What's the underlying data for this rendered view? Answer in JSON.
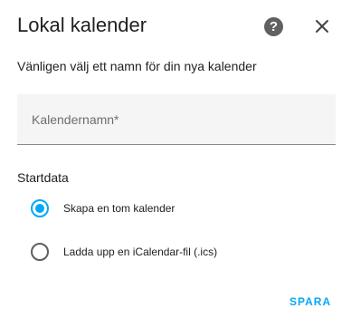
{
  "dialog": {
    "title": "Lokal kalender",
    "help_icon": "help-circle-icon",
    "close_icon": "close-icon",
    "subtitle": "Vänligen välj ett namn för din nya kalender"
  },
  "name_field": {
    "placeholder": "Kalendernamn*",
    "value": ""
  },
  "start_section": {
    "label": "Startdata",
    "options": [
      {
        "label": "Skapa en tom kalender",
        "checked": true
      },
      {
        "label": "Ladda upp en iCalendar-fil (.ics)",
        "checked": false
      }
    ]
  },
  "actions": {
    "save_label": "SPARA"
  },
  "colors": {
    "accent": "#03a9f4",
    "text": "#212121",
    "icon": "#616161",
    "field_bg": "#f5f5f5"
  }
}
